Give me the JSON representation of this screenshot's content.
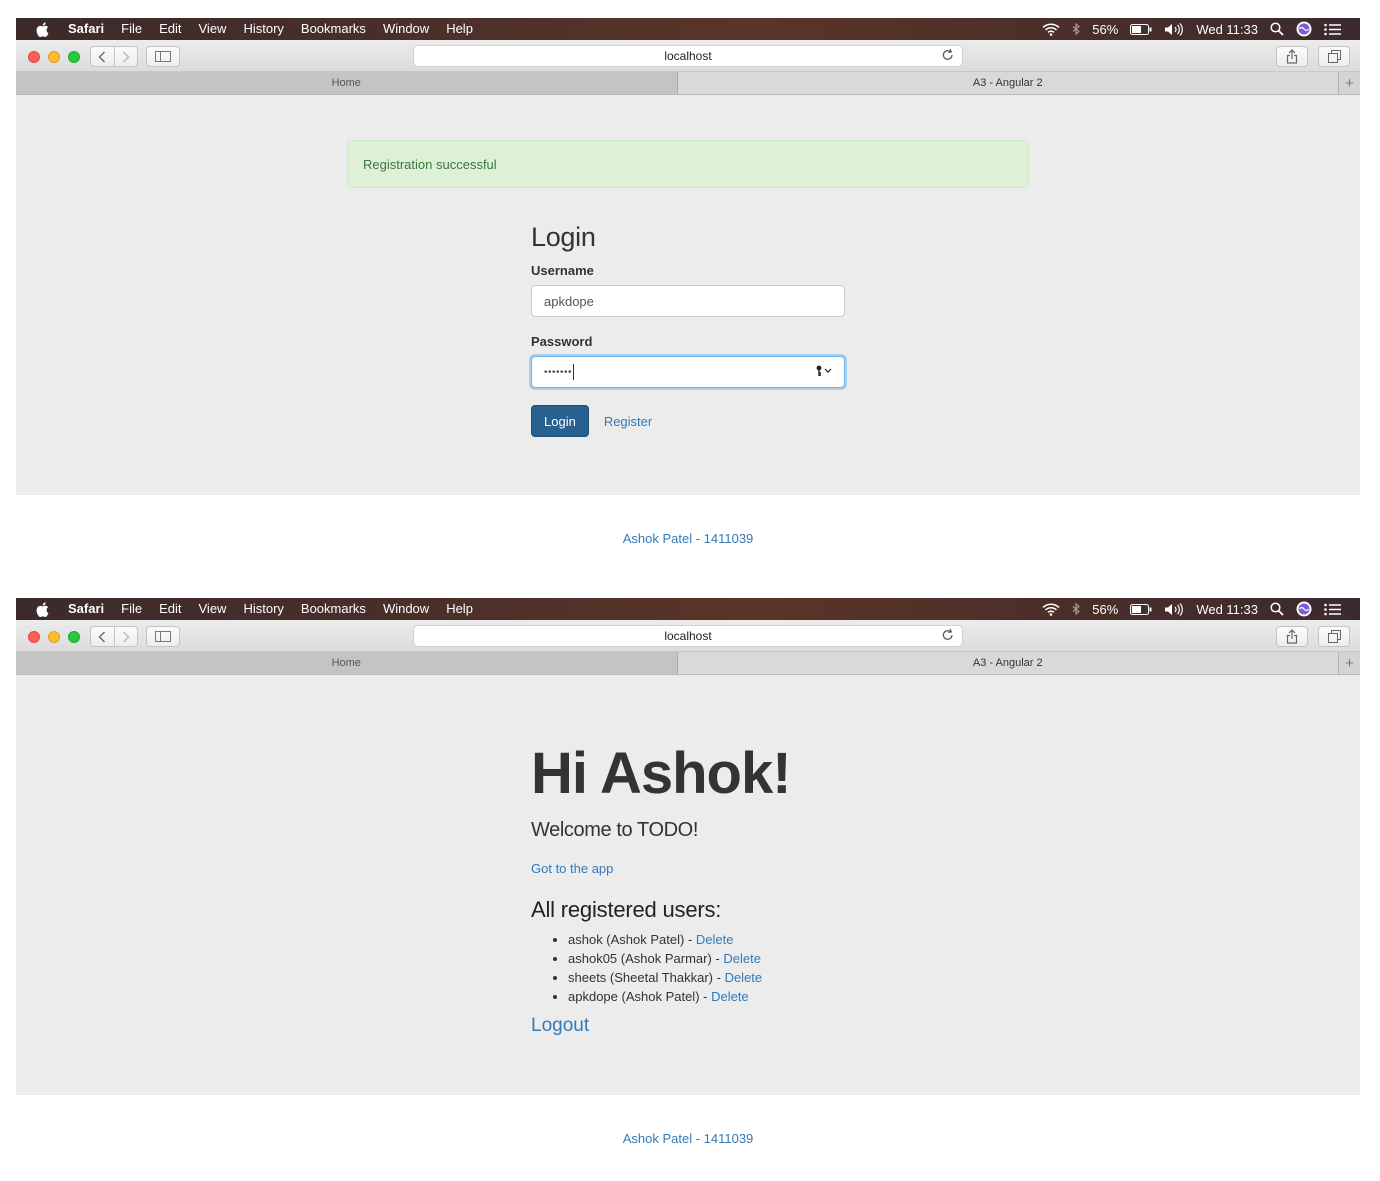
{
  "menubar": {
    "app": "Safari",
    "items": [
      "File",
      "Edit",
      "View",
      "History",
      "Bookmarks",
      "Window",
      "Help"
    ],
    "battery": "56%",
    "clock": "Wed 11:33",
    "icons": [
      "apple-icon",
      "wifi-icon",
      "bluetooth-icon",
      "battery-icon",
      "volume-icon",
      "spotlight-icon",
      "siri-icon",
      "notification-center-icon"
    ]
  },
  "browser": {
    "address": "localhost",
    "tabs": [
      "Home",
      "A3 - Angular 2"
    ],
    "icons": [
      "back-icon",
      "forward-icon",
      "sidebar-icon",
      "reload-icon",
      "share-icon",
      "tabs-overview-icon",
      "new-tab-icon"
    ]
  },
  "login": {
    "alert": "Registration successful",
    "heading": "Login",
    "username_label": "Username",
    "username_value": "apkdope",
    "password_label": "Password",
    "password_value": "•••••••",
    "submit_label": "Login",
    "register_label": "Register"
  },
  "home": {
    "greeting": "Hi Ashok!",
    "lead": "Welcome to TODO!",
    "app_link": "Got to the app",
    "users_heading": "All registered users:",
    "users": [
      {
        "text": "ashok (Ashok Patel) - ",
        "delete": "Delete"
      },
      {
        "text": "ashok05 (Ashok Parmar) - ",
        "delete": "Delete"
      },
      {
        "text": "sheets (Sheetal Thakkar) - ",
        "delete": "Delete"
      },
      {
        "text": "apkdope (Ashok Patel) - ",
        "delete": "Delete"
      }
    ],
    "logout": "Logout"
  },
  "footer": {
    "credit": "Ashok Patel - 1411039"
  },
  "colors": {
    "link": "#337ab7",
    "primary_button": "#286090",
    "alert_bg": "#dff0d8",
    "alert_text": "#3c763d",
    "page_bg": "#ececec"
  }
}
